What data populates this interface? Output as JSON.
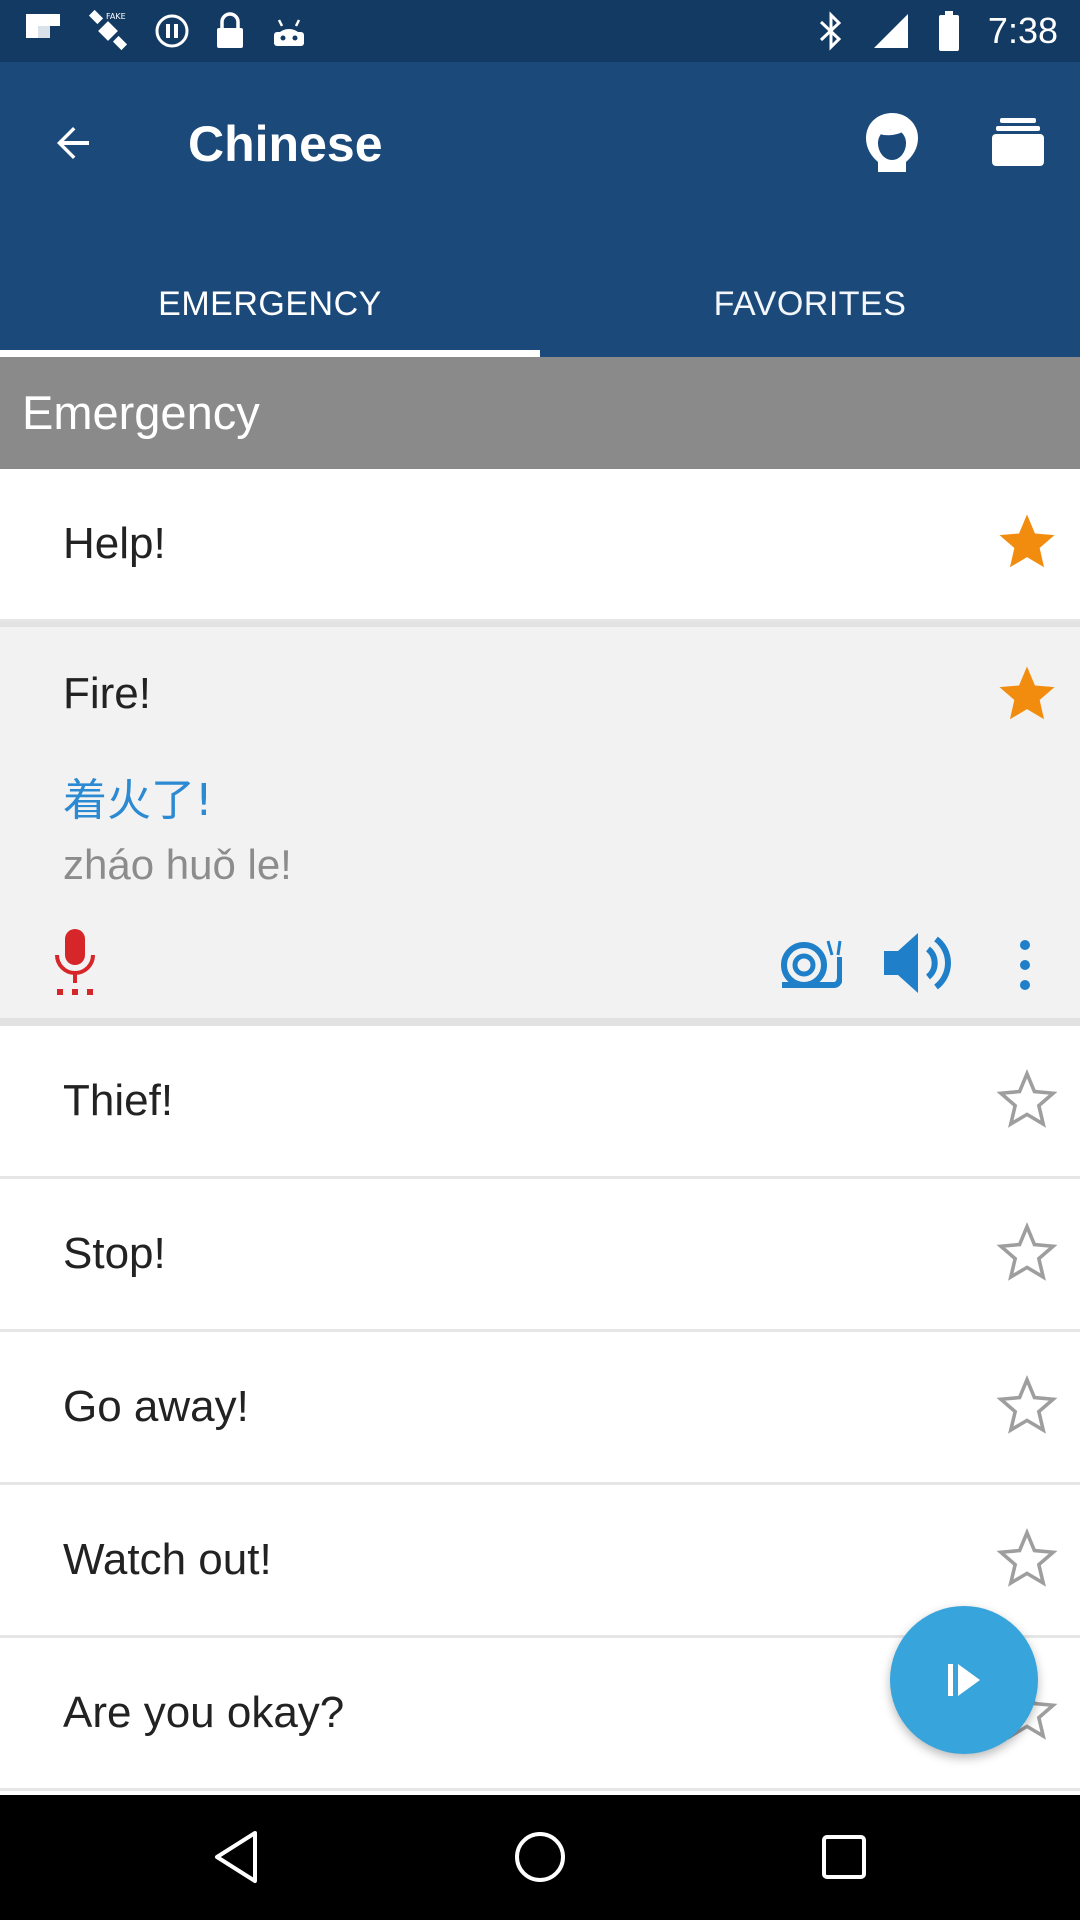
{
  "status_bar": {
    "time": "7:38",
    "left_icons": [
      "flipboard-icon",
      "satellite-fake-gps-icon",
      "pause-circle-icon",
      "lock-icon",
      "android-robot-icon"
    ],
    "right_icons": [
      "bluetooth-icon",
      "signal-icon",
      "battery-icon"
    ]
  },
  "app_bar": {
    "title": "Chinese",
    "back_icon": "arrow-back-icon",
    "actions": [
      "head-icon",
      "cards-stack-icon"
    ]
  },
  "tabs": [
    {
      "label": "EMERGENCY",
      "active": true
    },
    {
      "label": "FAVORITES",
      "active": false
    }
  ],
  "section": {
    "title": "Emergency"
  },
  "phrases": [
    {
      "text": "Help!",
      "favorite": true
    },
    {
      "text": "Fire!",
      "favorite": true,
      "expanded": true,
      "chinese": "着火了!",
      "pinyin": "zháo huǒ le!"
    },
    {
      "text": "Thief!",
      "favorite": false
    },
    {
      "text": "Stop!",
      "favorite": false
    },
    {
      "text": "Go away!",
      "favorite": false
    },
    {
      "text": "Watch out!",
      "favorite": false
    },
    {
      "text": "Are you okay?",
      "favorite": false
    }
  ],
  "colors": {
    "status_bar": "#123a63",
    "app_bar": "#1b4a7a",
    "section_header": "#8a8a8a",
    "star_active": "#f28c0f",
    "star_inactive": "#9e9e9e",
    "chinese_text": "#2b8ad2",
    "accent_blue": "#1f7fc9",
    "mic_red": "#d7262a",
    "fab": "#37a4dc"
  },
  "fab": {
    "icon": "play-next-icon"
  },
  "nav_bar": {
    "buttons": [
      "back-triangle-icon",
      "home-circle-icon",
      "recents-square-icon"
    ]
  }
}
